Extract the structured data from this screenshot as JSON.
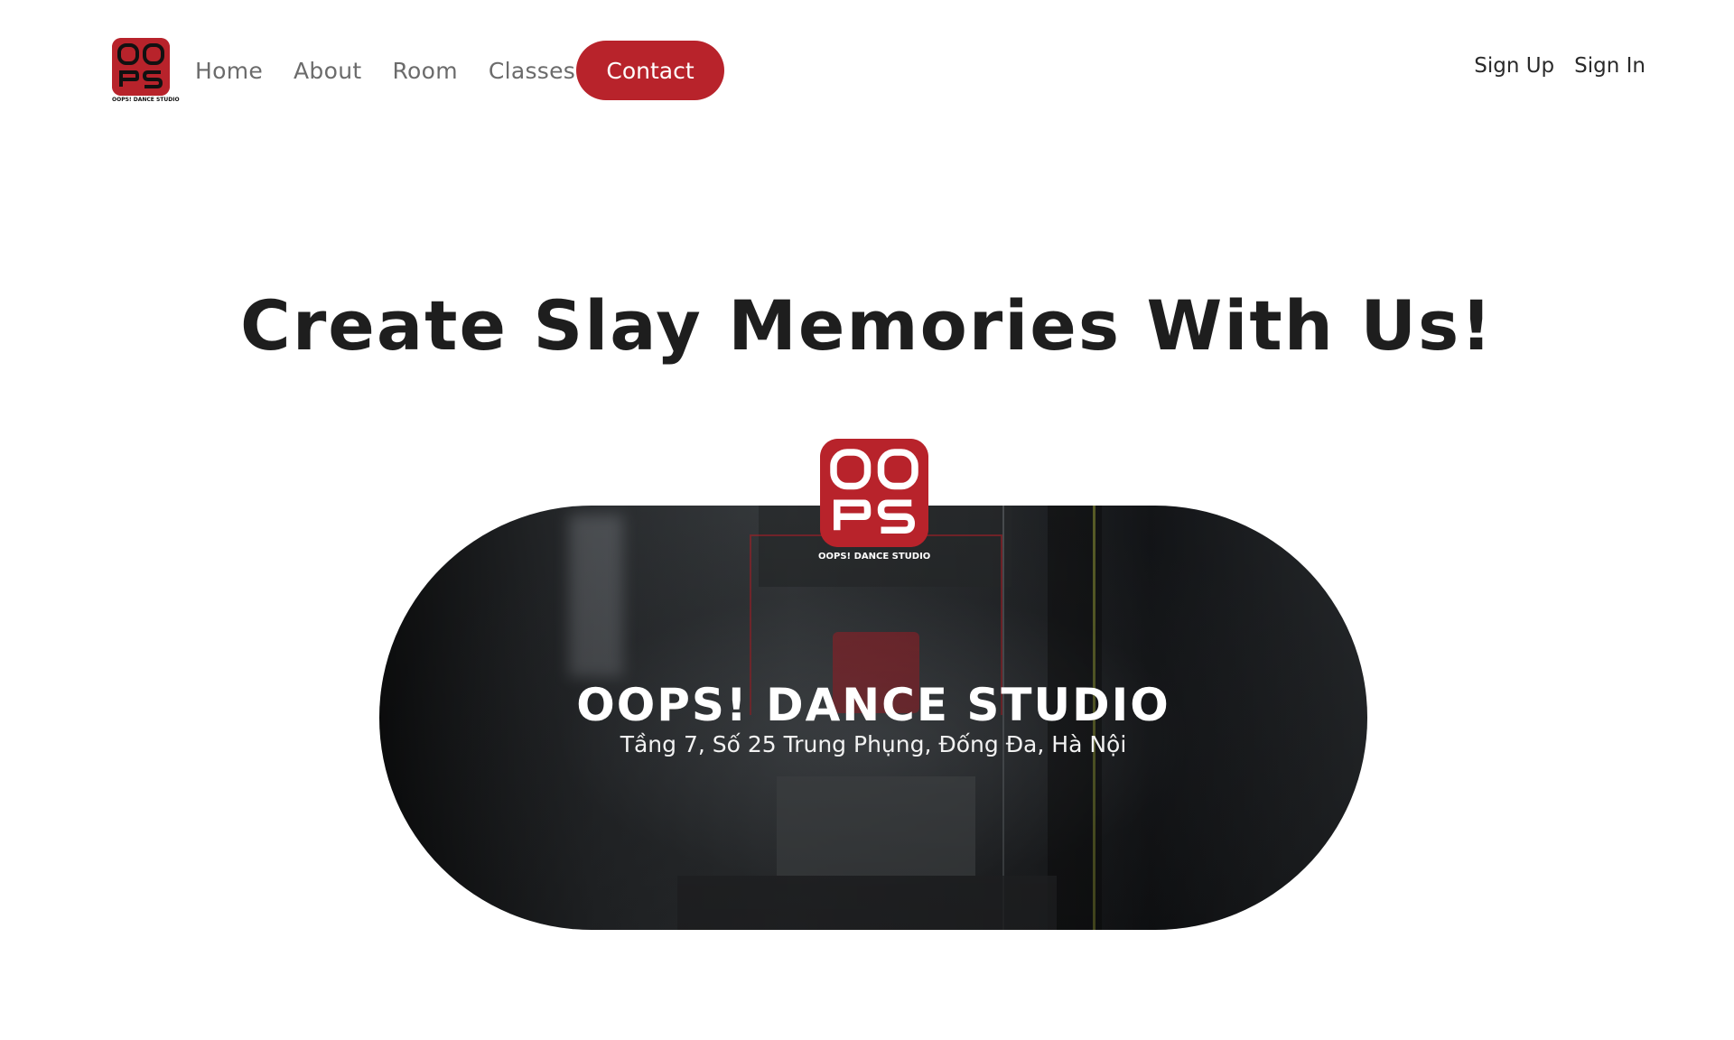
{
  "brand": {
    "logo_caption": "OOPS! DANCE STUDIO",
    "accent_color": "#b8232b"
  },
  "nav": {
    "items": [
      {
        "label": "Home"
      },
      {
        "label": "About"
      },
      {
        "label": "Room"
      },
      {
        "label": "Classes"
      }
    ],
    "contact_label": "Contact"
  },
  "auth": {
    "sign_up": "Sign Up",
    "sign_in": "Sign In"
  },
  "hero": {
    "title": "Create Slay Memories With Us!"
  },
  "video": {
    "badge_caption": "OOPS! DANCE STUDIO",
    "title": "OOPS! DANCE STUDIO",
    "address": "Tầng 7, Số 25 Trung Phụng, Đống Đa, Hà Nội"
  }
}
